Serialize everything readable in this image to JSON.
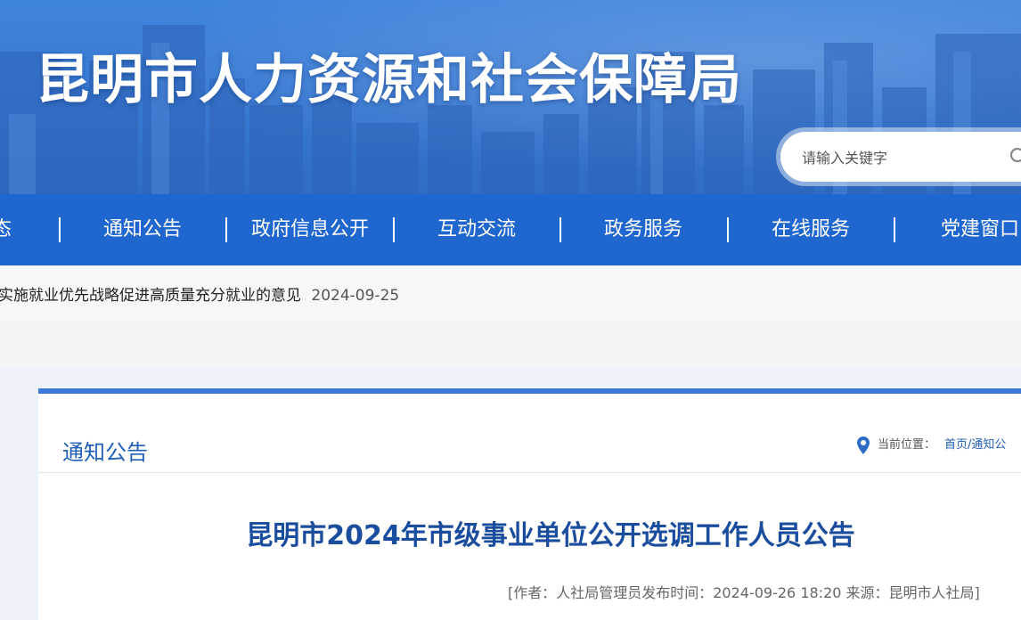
{
  "site": {
    "title": "昆明市人力资源和社会保障局"
  },
  "search": {
    "placeholder": "请输入关键字"
  },
  "nav": {
    "items": [
      "态",
      "通知公告",
      "政府信息公开",
      "互动交流",
      "政务服务",
      "在线服务",
      "党建窗口"
    ]
  },
  "ticker": {
    "text": "实施就业优先战略促进高质量充分就业的意见",
    "date": "2024-09-25"
  },
  "section": {
    "title": "通知公告"
  },
  "breadcrumb": {
    "label": "当前位置：",
    "path": "首页/通知公"
  },
  "article": {
    "title": "昆明市2024年市级事业单位公开选调工作人员公告",
    "meta": "[作者：人社局管理员发布时间：2024-09-26 18:20 来源：昆明市人社局]"
  },
  "colors": {
    "nav_bg": "#1f66cf",
    "accent": "#3b78d8",
    "title_text": "#1a4d9e"
  }
}
